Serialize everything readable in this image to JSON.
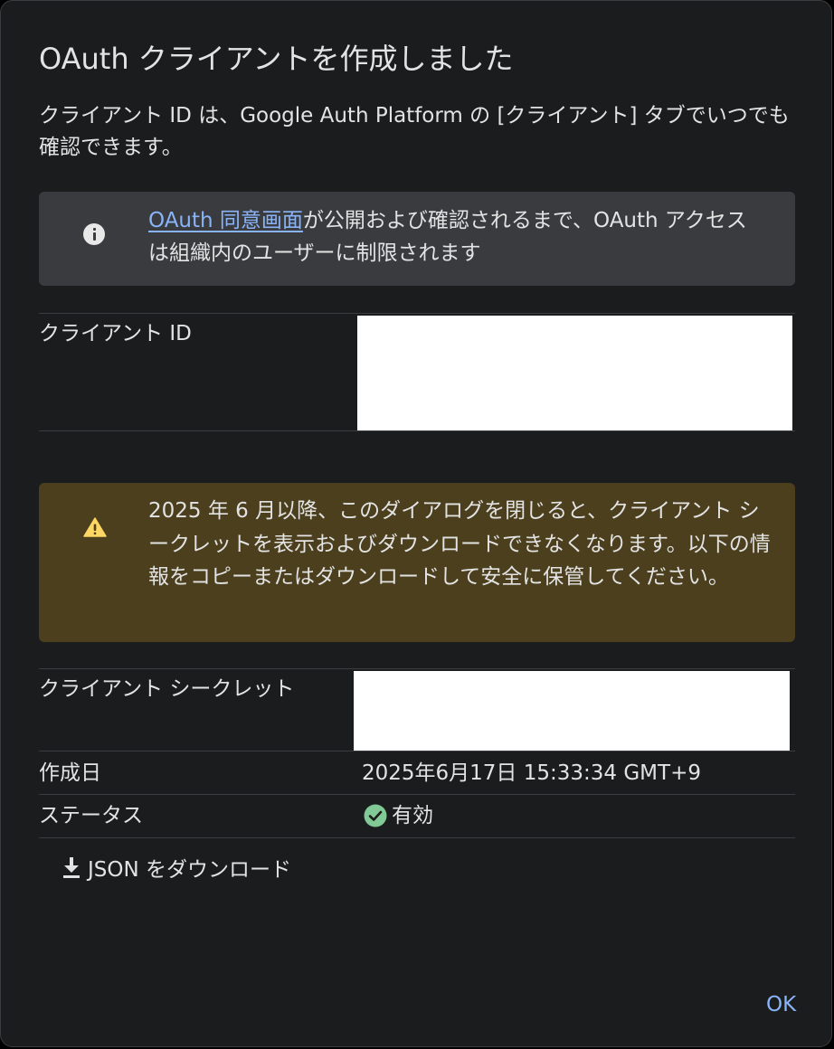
{
  "dialog": {
    "title": "OAuth クライアントを作成しました",
    "description": "クライアント ID は、Google Auth Platform の [クライアント] タブでいつでも確認できます。"
  },
  "info_banner": {
    "icon": "info-icon",
    "link_text": "OAuth 同意画面",
    "text": "が公開および確認されるまで、OAuth アクセスは組織内のユーザーに制限されます"
  },
  "client_id": {
    "label": "クライアント ID"
  },
  "warning_banner": {
    "icon": "warning-icon",
    "text": "2025 年 6 月以降、このダイアログを閉じると、クライアント シークレットを表示およびダウンロードできなくなります。以下の情報をコピーまたはダウンロードして安全に保管してください。"
  },
  "client_secret": {
    "label": "クライアント シークレット"
  },
  "created": {
    "label": "作成日",
    "value": "2025年6月17日 15:33:34 GMT+9"
  },
  "status": {
    "label": "ステータス",
    "value": "有効",
    "icon": "check-circle-icon"
  },
  "download": {
    "icon": "download-icon",
    "label": "JSON をダウンロード"
  },
  "actions": {
    "ok_label": "OK"
  },
  "colors": {
    "dialog_bg": "#1b1c1e",
    "info_bg": "#3a3b3f",
    "warning_bg": "#4b3f1d",
    "warning_icon": "#fdd663",
    "link": "#8ab4f8",
    "status_ok": "#81c995"
  }
}
